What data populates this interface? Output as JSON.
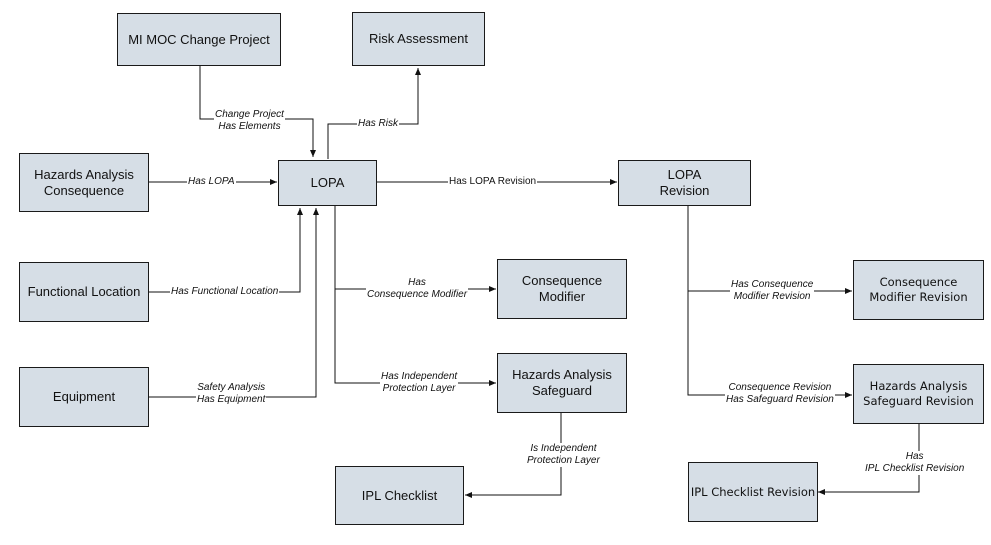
{
  "nodes": {
    "mi_moc": "MI MOC Change Project",
    "risk_assessment": "Risk Assessment",
    "ha_consequence": "Hazards Analysis\nConsequence",
    "lopa": "LOPA",
    "lopa_revision": "LOPA\nRevision",
    "functional_location": "Functional Location",
    "equipment": "Equipment",
    "consequence_modifier": "Consequence\nModifier",
    "ha_safeguard": "Hazards Analysis\nSafeguard",
    "ipl_checklist": "IPL Checklist",
    "consequence_modifier_revision": "Consequence\nModifier Revision",
    "ha_safeguard_revision": "Hazards Analysis\nSafeguard Revision",
    "ipl_checklist_revision": "IPL Checklist Revision"
  },
  "relationships": {
    "change_project_has_elements": "Change Project\nHas Elements",
    "has_risk": "Has Risk",
    "has_lopa": "Has LOPA",
    "has_lopa_revision": "Has LOPA Revision",
    "has_functional_location": "Has Functional Location",
    "safety_analysis_has_equipment": "Safety Analysis\nHas Equipment",
    "has_consequence_modifier": "Has\nConsequence Modifier",
    "has_independent_protection_layer": "Has Independent\nProtection Layer",
    "is_independent_protection_layer": "Is Independent\nProtection Layer",
    "has_consequence_modifier_revision": "Has Consequence\nModifier Revision",
    "consequence_revision_has_safeguard_revision": "Consequence Revision\nHas Safeguard Revision",
    "has_ipl_checklist_revision": "Has\nIPL Checklist Revision"
  }
}
